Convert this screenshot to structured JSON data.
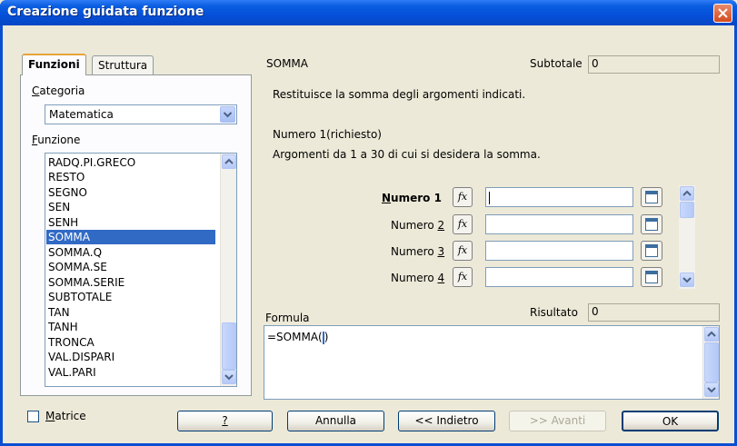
{
  "window": {
    "title": "Creazione guidata funzione"
  },
  "tabs": [
    {
      "label": "Funzioni",
      "active": true
    },
    {
      "label": "Struttura",
      "active": false
    }
  ],
  "left": {
    "category_label": "Categoria",
    "category_value": "Matematica",
    "function_label": "Funzione",
    "functions": [
      "RADQ.PI.GRECO",
      "RESTO",
      "SEGNO",
      "SEN",
      "SENH",
      "SOMMA",
      "SOMMA.Q",
      "SOMMA.SE",
      "SOMMA.SERIE",
      "SUBTOTALE",
      "TAN",
      "TANH",
      "TRONCA",
      "VAL.DISPARI",
      "VAL.PARI"
    ],
    "selected_function": "SOMMA",
    "matrix_label": "Matrice"
  },
  "right": {
    "function_name": "SOMMA",
    "subtotal_label": "Subtotale",
    "subtotal_value": "0",
    "description": "Restituisce la somma degli argomenti indicati.",
    "arg_title": "Numero 1(richiesto)",
    "arg_description": "Argomenti da 1 a 30 di cui si desidera la somma.",
    "args": [
      {
        "label": "Numero 1",
        "value": ""
      },
      {
        "label": "Numero 2",
        "value": ""
      },
      {
        "label": "Numero 3",
        "value": ""
      },
      {
        "label": "Numero 4",
        "value": ""
      }
    ],
    "fx_symbol": "fx",
    "formula_label": "Formula",
    "result_label": "Risultato",
    "result_value": "0",
    "formula_before_caret": "=SOMMA(",
    "formula_after_caret": ")"
  },
  "buttons": {
    "help": "?",
    "cancel": "Annulla",
    "back": "<< Indietro",
    "next": ">> Avanti",
    "ok": "OK"
  }
}
